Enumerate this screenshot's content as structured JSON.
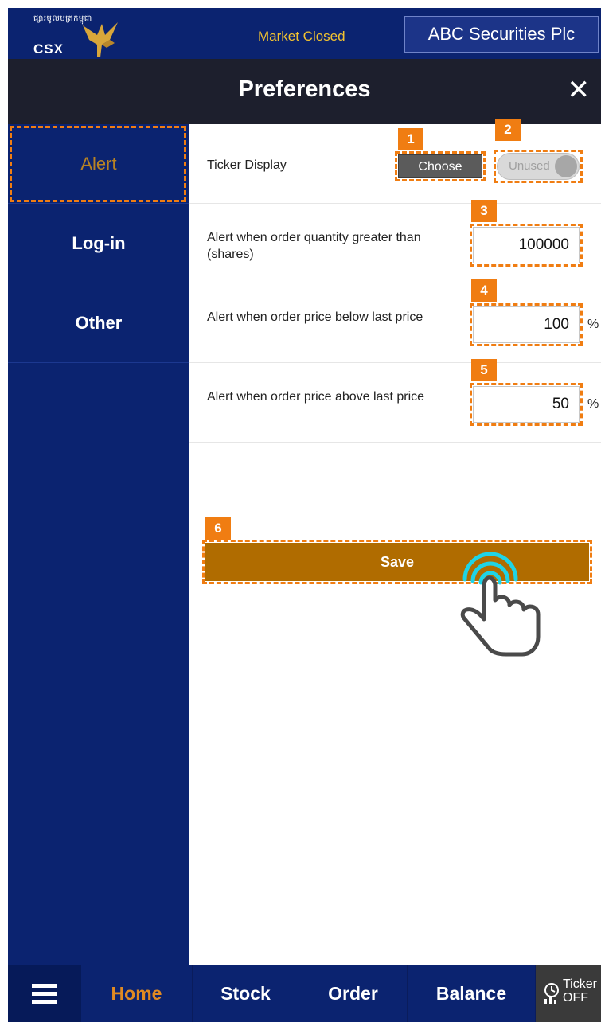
{
  "header": {
    "logo_khmer": "ផ្សារមូលបត្រកម្ពុជា",
    "logo_text": "CSX",
    "market_status": "Market Closed",
    "broker_name": "ABC Securities Plc"
  },
  "titlebar": {
    "title": "Preferences",
    "close_glyph": "✕"
  },
  "sidebar": {
    "items": [
      {
        "label": "Alert",
        "active": true
      },
      {
        "label": "Log-in",
        "active": false
      },
      {
        "label": "Other",
        "active": false
      }
    ]
  },
  "settings": {
    "ticker_display": {
      "label": "Ticker Display",
      "choose_label": "Choose",
      "toggle_text": "Unused"
    },
    "quantity_alert": {
      "label": "Alert when order quantity greater than (shares)",
      "value": "100000"
    },
    "price_below_alert": {
      "label": "Alert when order price below last price",
      "value": "100",
      "unit": "%"
    },
    "price_above_alert": {
      "label": "Alert when order price above last price",
      "value": "50",
      "unit": "%"
    },
    "save_label": "Save"
  },
  "callouts": [
    "1",
    "2",
    "3",
    "4",
    "5",
    "6"
  ],
  "bottom_nav": {
    "items": [
      {
        "label": "Home",
        "active": true
      },
      {
        "label": "Stock",
        "active": false
      },
      {
        "label": "Order",
        "active": false
      },
      {
        "label": "Balance",
        "active": false
      }
    ],
    "ticker_label_1": "Ticker",
    "ticker_label_2": "OFF"
  },
  "colors": {
    "primary_navy": "#0b2370",
    "titlebar_dark": "#1d1f2d",
    "accent_orange": "#f07d12",
    "save_brown": "#b06c00",
    "market_status_yellow": "#f2c230",
    "active_nav_orange": "#e08a22"
  },
  "icons": {
    "close": "close-icon",
    "menu": "hamburger-menu-icon",
    "ticker": "ticker-icon",
    "hand": "tap-hand-icon",
    "logo": "csx-bird-logo"
  }
}
